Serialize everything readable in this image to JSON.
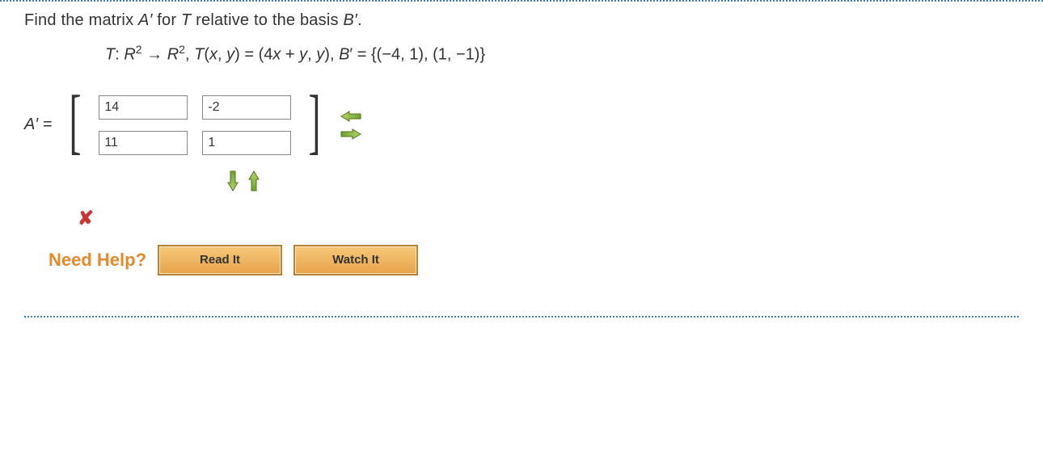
{
  "question": {
    "prompt_pre": "Find the matrix ",
    "Aprime": "A′",
    "prompt_mid": " for ",
    "T": "T",
    "prompt_post": " relative to the basis ",
    "Bprime": "B′",
    "period": "."
  },
  "formula": {
    "text": "T: R² → R², T(x, y) = (4x + y, y), B′ = {(−4, 1), (1, −1)}"
  },
  "matrix": {
    "label": "A′ =",
    "cells": {
      "r0c0": "14",
      "r0c1": "-2",
      "r1c0": "11",
      "r1c1": "1"
    }
  },
  "feedback": {
    "incorrect_symbol": "✘"
  },
  "help": {
    "label": "Need Help?",
    "read": "Read It",
    "watch": "Watch It"
  }
}
